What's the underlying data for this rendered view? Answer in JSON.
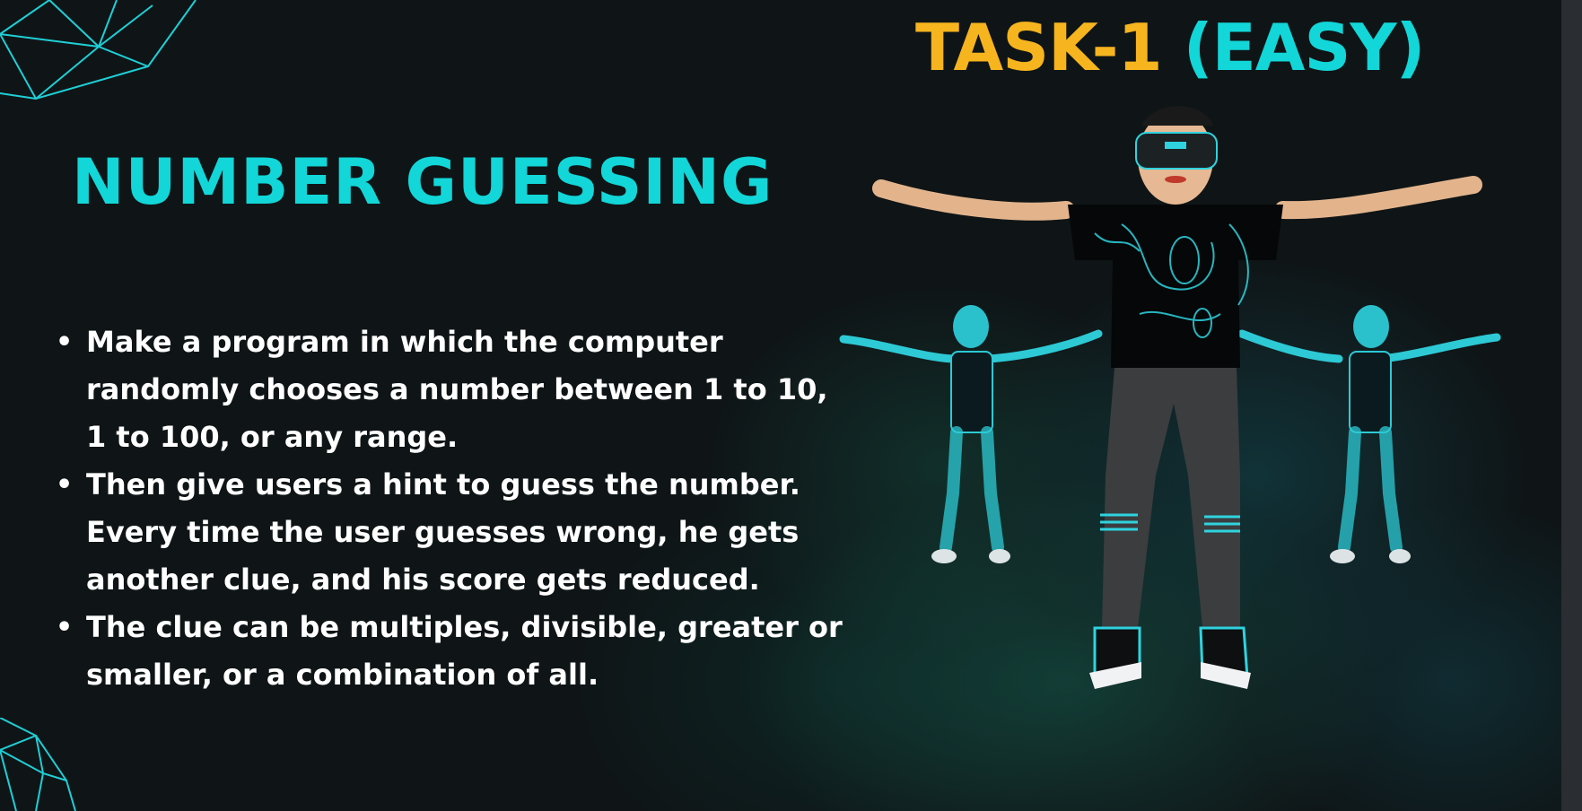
{
  "slide": {
    "task_title_part1": "TASK-1",
    "task_title_part2": "(EASY)",
    "main_title": "NUMBER GUESSING",
    "bullets": [
      " Make a program in which the computer randomly chooses a number between 1 to 10, 1 to 100, or any range.",
      " Then give users a hint to guess the number. Every time the user guesses wrong, he gets another clue, and his score gets reduced.",
      "The clue can be multiples, divisible, greater or smaller, or a combination of all."
    ],
    "colors": {
      "accent_cyan": "#12d6d8",
      "accent_orange": "#f6b41e",
      "background": "#0f1517",
      "text": "#ffffff"
    },
    "images": {
      "main_figure": "vr-headset-avatar-illustration",
      "side_figures": "wireframe-avatar-illustration"
    }
  }
}
